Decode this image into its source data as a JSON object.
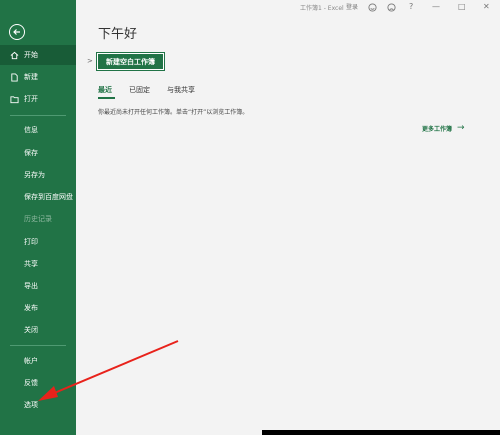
{
  "window": {
    "title": "工作簿1  -  Excel",
    "signin": "登录",
    "help": "?",
    "minimize": "—",
    "restore": "□",
    "close": "✕"
  },
  "sidebar": {
    "items": [
      {
        "label": "开始",
        "icon": "home-icon",
        "active": true
      },
      {
        "label": "新建",
        "icon": "new-file-icon"
      },
      {
        "label": "打开",
        "icon": "open-folder-icon"
      },
      {
        "label": "信息"
      },
      {
        "label": "保存"
      },
      {
        "label": "另存为"
      },
      {
        "label": "保存到百度网盘"
      },
      {
        "label": "历史记录",
        "disabled": true
      },
      {
        "label": "打印"
      },
      {
        "label": "共享"
      },
      {
        "label": "导出"
      },
      {
        "label": "发布"
      },
      {
        "label": "关闭"
      },
      {
        "label": "帐户"
      },
      {
        "label": "反馈"
      },
      {
        "label": "选项"
      }
    ]
  },
  "main": {
    "greeting": "下午好",
    "new_workbook": "新建空白工作簿",
    "tabs": [
      "最近",
      "已固定",
      "与我共享"
    ],
    "empty_message": "你最近尚未打开任何工作簿。单击“打开”以浏览工作簿。",
    "more_workbooks": "更多工作簿",
    "more_arrow": "→"
  },
  "colors": {
    "accent": "#217346",
    "annotation": "#e8221b"
  }
}
